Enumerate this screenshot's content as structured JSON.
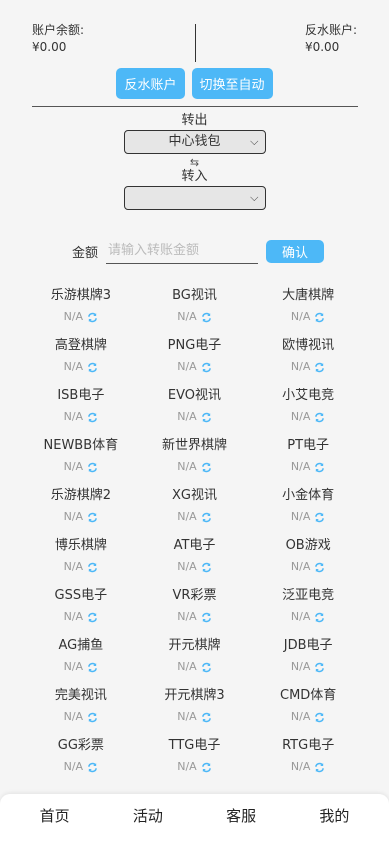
{
  "balances": {
    "account_label": "账户余额:",
    "account_value": "¥0.00",
    "rebate_label": "反水账户:",
    "rebate_value": "¥0.00"
  },
  "actions": {
    "rebate_button": "反水账户",
    "auto_button": "切换至自动"
  },
  "transfer": {
    "out_label": "转出",
    "out_selected": "中心钱包",
    "swap_symbol": "⇆",
    "in_label": "转入",
    "in_selected": ""
  },
  "amount": {
    "label": "金额",
    "placeholder": "请输入转账金额",
    "confirm_button": "确认"
  },
  "games": [
    {
      "name": "乐游棋牌3",
      "value": "N/A"
    },
    {
      "name": "BG视讯",
      "value": "N/A"
    },
    {
      "name": "大唐棋牌",
      "value": "N/A"
    },
    {
      "name": "高登棋牌",
      "value": "N/A"
    },
    {
      "name": "PNG电子",
      "value": "N/A"
    },
    {
      "name": "欧博视讯",
      "value": "N/A"
    },
    {
      "name": "ISB电子",
      "value": "N/A"
    },
    {
      "name": "EVO视讯",
      "value": "N/A"
    },
    {
      "name": "小艾电竞",
      "value": "N/A"
    },
    {
      "name": "NEWBB体育",
      "value": "N/A"
    },
    {
      "name": "新世界棋牌",
      "value": "N/A"
    },
    {
      "name": "PT电子",
      "value": "N/A"
    },
    {
      "name": "乐游棋牌2",
      "value": "N/A"
    },
    {
      "name": "XG视讯",
      "value": "N/A"
    },
    {
      "name": "小金体育",
      "value": "N/A"
    },
    {
      "name": "博乐棋牌",
      "value": "N/A"
    },
    {
      "name": "AT电子",
      "value": "N/A"
    },
    {
      "name": "OB游戏",
      "value": "N/A"
    },
    {
      "name": "GSS电子",
      "value": "N/A"
    },
    {
      "name": "VR彩票",
      "value": "N/A"
    },
    {
      "name": "泛亚电竞",
      "value": "N/A"
    },
    {
      "name": "AG捕鱼",
      "value": "N/A"
    },
    {
      "name": "开元棋牌",
      "value": "N/A"
    },
    {
      "name": "JDB电子",
      "value": "N/A"
    },
    {
      "name": "完美视讯",
      "value": "N/A"
    },
    {
      "name": "开元棋牌3",
      "value": "N/A"
    },
    {
      "name": "CMD体育",
      "value": "N/A"
    },
    {
      "name": "GG彩票",
      "value": "N/A"
    },
    {
      "name": "TTG电子",
      "value": "N/A"
    },
    {
      "name": "RTG电子",
      "value": "N/A"
    }
  ],
  "nav": {
    "home": "首页",
    "activity": "活动",
    "service": "客服",
    "mine": "我的"
  },
  "colors": {
    "accent": "#4db8f7",
    "refresh_icon": "#4db8f7"
  }
}
